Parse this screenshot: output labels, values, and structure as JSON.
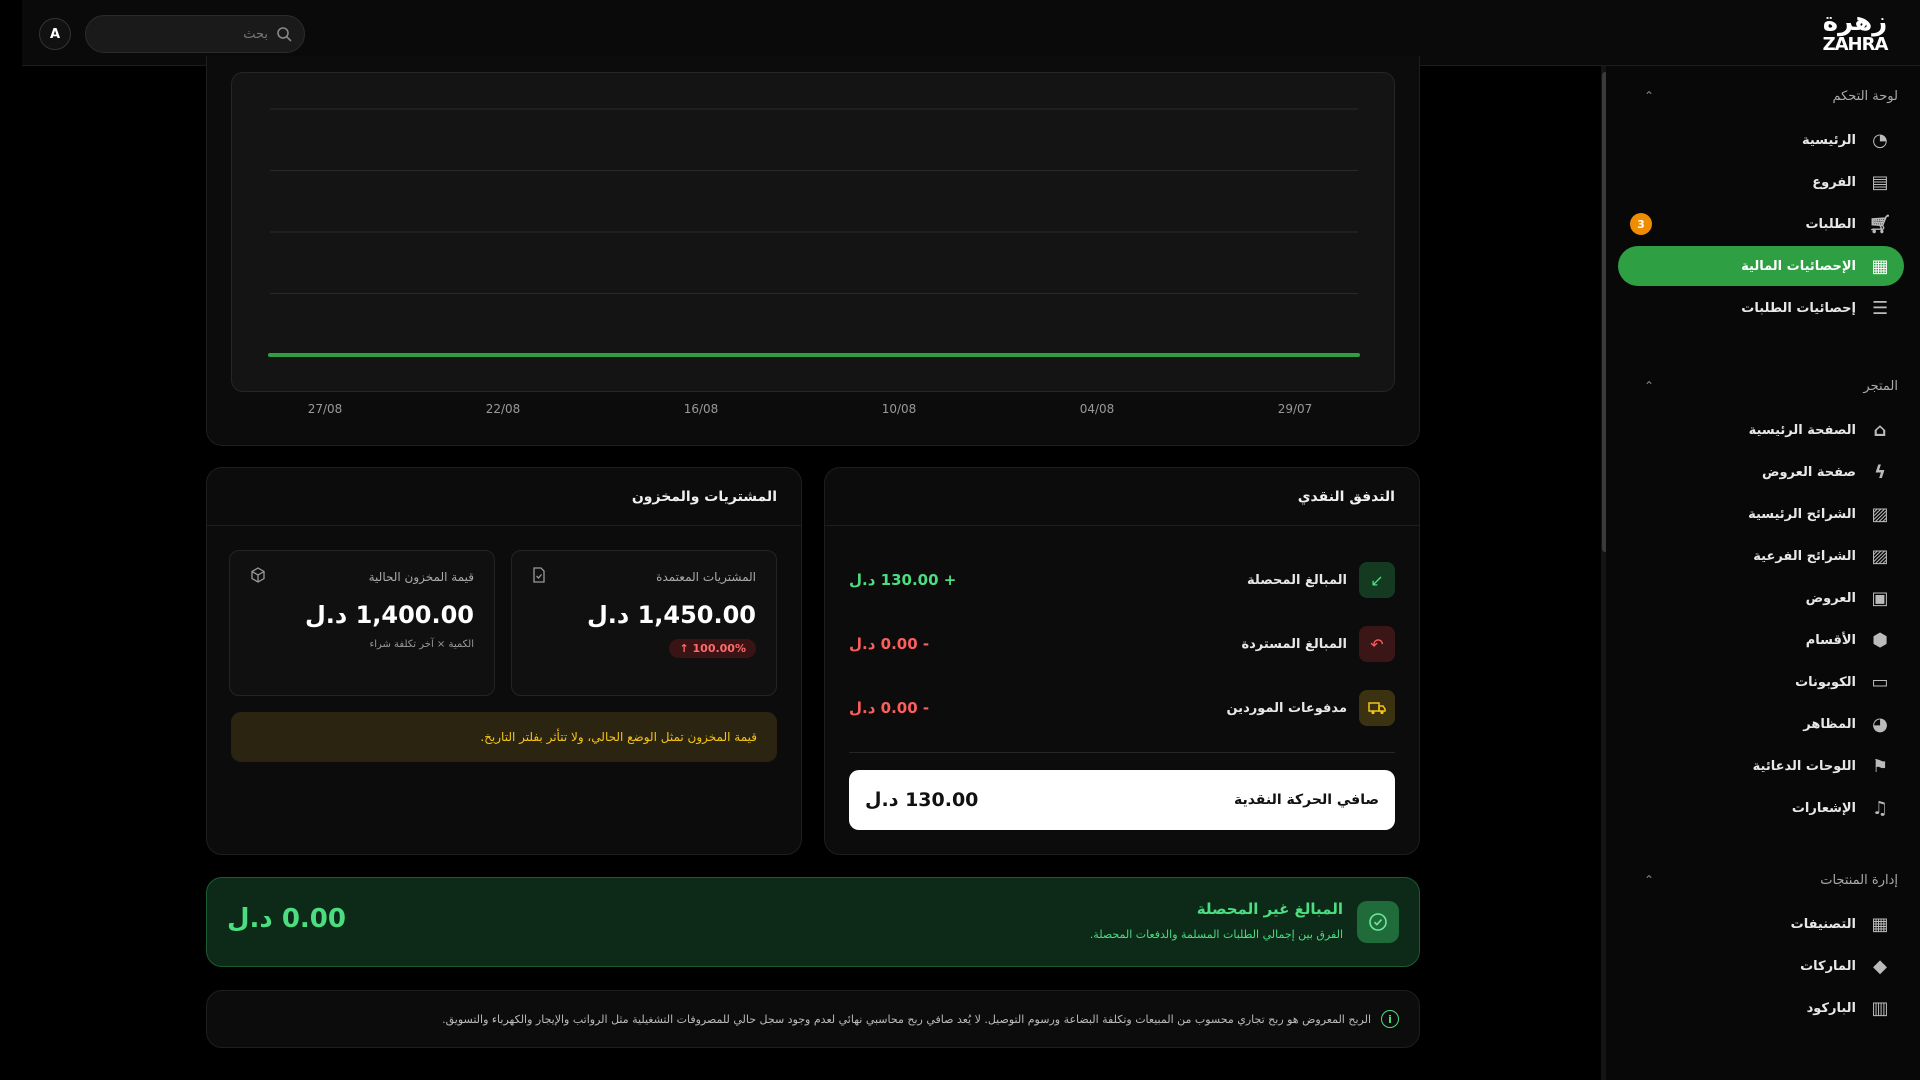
{
  "header": {
    "avatar_initial": "A",
    "search_placeholder": "بحث",
    "logo_ar": "زهرة",
    "logo_en": "ZAHRA"
  },
  "sidebar": {
    "sections": [
      {
        "title": "لوحة التحكم",
        "items": [
          {
            "label": "الرئيسية",
            "icon": "dashboard-gauge-icon"
          },
          {
            "label": "الفروع",
            "icon": "store-icon"
          },
          {
            "label": "الطلبات",
            "icon": "cart-icon",
            "badge": "3"
          },
          {
            "label": "الإحصائيات المالية",
            "icon": "financial-stats-icon",
            "active": true
          },
          {
            "label": "إحصائيات الطلبات",
            "icon": "list-stats-icon"
          }
        ]
      },
      {
        "title": "المتجر",
        "items": [
          {
            "label": "الصفحة الرئيسية",
            "icon": "home-icon"
          },
          {
            "label": "صفحة العروض",
            "icon": "lightning-icon"
          },
          {
            "label": "الشرائح الرئيسية",
            "icon": "image-slides-icon"
          },
          {
            "label": "الشرائح الفرعية",
            "icon": "image-slides-icon"
          },
          {
            "label": "العروض",
            "icon": "gift-icon"
          },
          {
            "label": "الأقسام",
            "icon": "box-icon"
          },
          {
            "label": "الكوبونات",
            "icon": "coupon-icon"
          },
          {
            "label": "المظاهر",
            "icon": "palette-icon"
          },
          {
            "label": "اللوحات الدعائية",
            "icon": "flag-icon"
          },
          {
            "label": "الإشعارات",
            "icon": "bell-icon"
          }
        ]
      },
      {
        "title": "إدارة المنتجات",
        "items": [
          {
            "label": "التصنيفات",
            "icon": "grid-icon"
          },
          {
            "label": "الماركات",
            "icon": "tag-icon"
          },
          {
            "label": "الباركود",
            "icon": "barcode-icon"
          }
        ]
      }
    ]
  },
  "chart_data": {
    "type": "line",
    "x": [
      "29/07",
      "04/08",
      "10/08",
      "16/08",
      "22/08",
      "27/08"
    ],
    "series": [
      {
        "values": [
          0,
          0,
          0,
          0,
          0,
          0
        ],
        "color": "#2ea043"
      }
    ],
    "gridlines": 5
  },
  "cash_flow": {
    "title": "التدفق النقدي",
    "rows": [
      {
        "label": "المبالغ المحصلة",
        "value": "+ 130.00 د.ل",
        "tone": "green",
        "icon": "arrow-down-left-icon"
      },
      {
        "label": "المبالغ المستردة",
        "value": "- 0.00 د.ل",
        "tone": "red",
        "icon": "undo-arrow-icon"
      },
      {
        "label": "مدفوعات الموردين",
        "value": "- 0.00 د.ل",
        "tone": "red",
        "icon": "truck-icon"
      }
    ],
    "net_label": "صافي الحركة النقدية",
    "net_value": "130.00 د.ل"
  },
  "purchases": {
    "title": "المشتريات والمخزون",
    "approved": {
      "label": "المشتريات المعتمدة",
      "value": "1,450.00 د.ل",
      "pill": "100.00% ↑"
    },
    "inventory": {
      "label": "قيمة المخزون الحالية",
      "value": "1,400.00 د.ل",
      "note": "الكمية × آخر تكلفة شراء"
    },
    "warning": "قيمة المخزون تمثل الوضع الحالي، ولا تتأثر بفلتر التاريخ."
  },
  "uncollected": {
    "title": "المبالغ غير المحصلة",
    "subtitle": "الفرق بين إجمالي الطلبات المسلمة والدفعات المحصلة.",
    "amount": "0.00 د.ل"
  },
  "info_note": "الربح المعروض هو ربح تجاري محسوب من المبيعات وتكلفة البضاعة ورسوم التوصيل. لا يُعد صافي ربح محاسبي نهائي لعدم وجود سجل حالي للمصروفات التشغيلية مثل الرواتب والإيجار والكهرباء والتسويق."
}
